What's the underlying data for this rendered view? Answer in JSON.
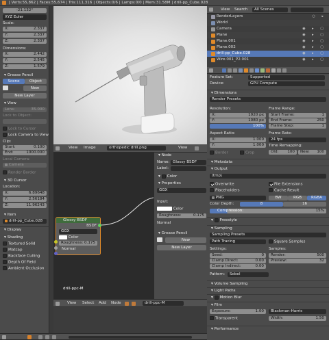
{
  "topbar": {
    "stats": "| Verts:55,862 | Faces:55,674 | Tris:111,316 | Objects:0/6 | Lamps:0/0 | Mem:31.58M | drill-pp_Cube.028"
  },
  "left_panel": {
    "rotation_value": "-21.132°",
    "rotation_mode": "XYZ Euler",
    "scale_header": "Scale:",
    "scale": [
      {
        "axis": "X:",
        "value": "2.337"
      },
      {
        "axis": "Y:",
        "value": "2.337"
      },
      {
        "axis": "Z:",
        "value": "2.337"
      }
    ],
    "dimensions_header": "Dimensions:",
    "dimensions": [
      {
        "axis": "X:",
        "value": "2.442"
      },
      {
        "axis": "Y:",
        "value": "2.545"
      },
      {
        "axis": "Z:",
        "value": "1.579"
      }
    ],
    "grease_pencil": "Grease Pencil",
    "tab_scene": "Scene",
    "tab_object": "Object",
    "new_label": "New",
    "new_layer": "New Layer",
    "view_header": "View",
    "lens_label": "Lens:",
    "lens_value": "35.000",
    "lock_to_object": "Lock to Object:",
    "lock_to_cursor": "Lock to Cursor",
    "lock_camera_to_view": "Lock Camera to View",
    "clip_header": "Clip:",
    "clip_start_label": "Start:",
    "clip_start": "0.100",
    "clip_end_label": "End:",
    "clip_end": "1000.000",
    "local_camera": "Local Camera:",
    "camera_value": "Camera",
    "render_border": "Render Border",
    "cursor_header": "3D Cursor",
    "location_header": "Location:",
    "location": [
      {
        "axis": "X:",
        "value": "6.89648"
      },
      {
        "axis": "Y:",
        "value": "2.56184"
      },
      {
        "axis": "Z:",
        "value": "11.96243"
      }
    ],
    "item_header": "Item",
    "item_name": "drill-pp_Cube.028",
    "display_header": "Display",
    "shading_header": "Shading",
    "shading_opts": [
      "Textured Solid",
      "Matcap",
      "Backface Culling",
      "Depth Of Field",
      "Ambient Occlusion"
    ]
  },
  "viewport_header": {
    "view": "View",
    "image": "Image",
    "image_name": "orthopedic drill.png",
    "view2": "View"
  },
  "node_editor": {
    "node_title": "Glossy BSDF",
    "node_output": "BSDF",
    "distribution": "GGX",
    "color_label": "Color",
    "roughness_label": "Roughness:",
    "roughness_value": "0.175",
    "normal_label": "Normal",
    "material_name": "drill-ppc-M",
    "menu": [
      "View",
      "Select",
      "Add",
      "Node"
    ],
    "material_field": "drill-ppc-M"
  },
  "node_props": {
    "header": "Node",
    "name_label": "Name:",
    "name_value": "Glossy BSDF",
    "label_label": "Label:",
    "color_header": "Color",
    "properties_header": "Properties",
    "distribution": "GGX",
    "inputs_label": "Input:",
    "color_label": "Color",
    "roughness_label": "Roughness:",
    "roughness_value": "0.175",
    "normal_label": "Normal",
    "grease_pencil": "Grease Pencil",
    "new_label": "New",
    "new_layer": "New Layer"
  },
  "outliner": {
    "menu": [
      "View",
      "Search"
    ],
    "scene_filter": "All Scenes",
    "items": [
      "RenderLayers",
      "World",
      "Camera",
      "Plane",
      "Plane.001",
      "Plane.002",
      "drill-pp_Cube.028",
      "Wire.001_P2.001"
    ]
  },
  "render_props": {
    "feature_set_label": "Feature Set:",
    "feature_set": "Supported",
    "device_label": "Device:",
    "device": "GPU Compute",
    "dimensions_header": "Dimensions",
    "render_presets": "Render Presets",
    "resolution_label": "Resolution:",
    "res_x": "1920 px",
    "res_y": "1080 px",
    "res_pct": "100%",
    "frame_range_label": "Frame Range:",
    "start_frame": "Start Frame:",
    "start_frame_val": "1",
    "end_frame": "End Frame:",
    "end_frame_val": "250",
    "frame_step": "Frame Step:",
    "frame_step_val": "1",
    "aspect_label": "Aspect Ratio:",
    "asp_x": "1.000",
    "asp_y": "1.000",
    "frame_rate_label": "Frame Rate:",
    "frame_rate": "24 fps",
    "time_remap": "Time Remapping:",
    "old_label": "Old:",
    "old_val": "100",
    "new_label": "New:",
    "new_val": "100",
    "border_label": "Border",
    "crop_label": "Crop",
    "metadata_header": "Metadata",
    "output_header": "Output",
    "output_path": "/tmp\\",
    "overwrite": "Overwrite",
    "file_ext": "File Extensions",
    "placeholders": "Placeholders",
    "cache_result": "Cache Result",
    "format": "PNG",
    "bw": "BW",
    "rgb": "RGB",
    "rgba": "RGBA",
    "color_depth_label": "Color Depth:",
    "depth_8": "8",
    "depth_16": "16",
    "compression_label": "Compression:",
    "compression": "15%",
    "freestyle_header": "Freestyle",
    "sampling_header": "Sampling",
    "sampling_presets": "Sampling Presets",
    "path_tracing": "Path Tracing",
    "square_samples": "Square Samples",
    "settings_label": "Settings:",
    "seed_label": "Seed:",
    "seed_val": "0",
    "clamp_direct": "Clamp Direct:",
    "clamp_direct_val": "0.00",
    "clamp_indirect": "Clamp Indirect:",
    "clamp_indirect_val": "0.00",
    "samples_label": "Samples:",
    "render_label": "Render:",
    "render_val": "500",
    "preview_label": "Preview:",
    "preview_val": "32",
    "pattern_label": "Pattern:",
    "pattern": "Sobol",
    "volume_header": "Volume Sampling",
    "light_paths_header": "Light Paths",
    "motion_blur_header": "Motion Blur",
    "film_header": "Film",
    "exposure_label": "Exposure:",
    "exposure_val": "1.00",
    "filter": "Blackman-Harris",
    "transparent": "Transparent",
    "width_label": "Width:",
    "width_val": "1.50",
    "performance_header": "Performance"
  },
  "colors": {
    "accent": "#5679b8",
    "orange": "#e08a2a",
    "green_link": "#c6d9a8"
  }
}
